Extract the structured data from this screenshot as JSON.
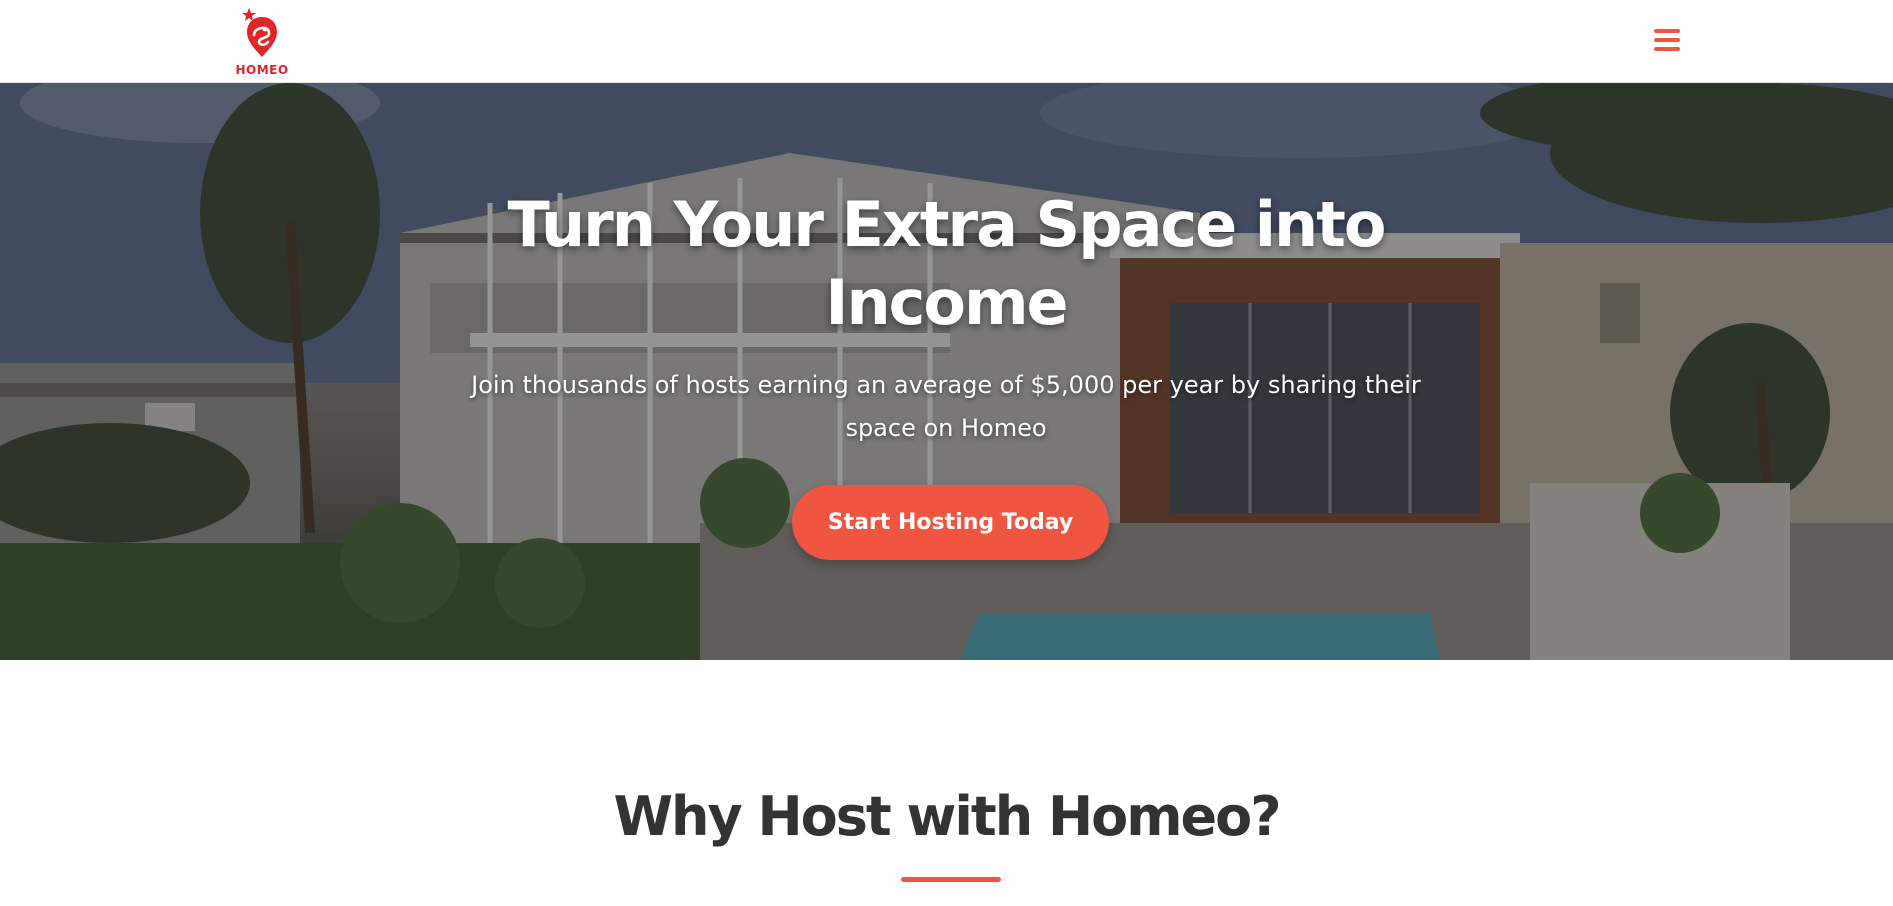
{
  "header": {
    "logo_text": "HOMEO",
    "logo_icon": "location-pin-icon",
    "menu_icon": "hamburger-menu-icon"
  },
  "hero": {
    "title": "Turn Your Extra Space into Income",
    "subtitle": "Join thousands of hosts earning an average of $5,000 per year by sharing their space on Homeo",
    "cta_label": "Start Hosting Today"
  },
  "section": {
    "title": "Why Host with Homeo?"
  },
  "colors": {
    "accent": "#f05542",
    "logo_red": "#e0262b",
    "text_dark": "#333333"
  }
}
